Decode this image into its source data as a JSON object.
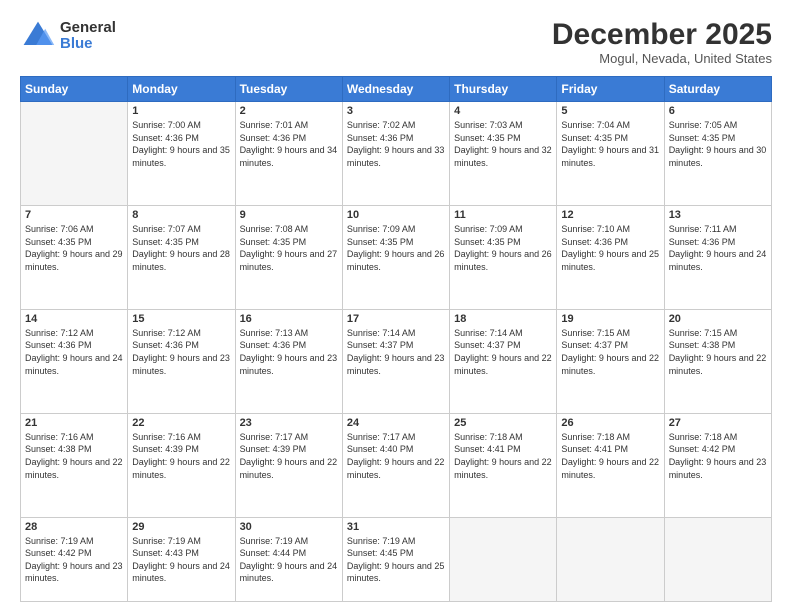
{
  "logo": {
    "general": "General",
    "blue": "Blue"
  },
  "title": "December 2025",
  "subtitle": "Mogul, Nevada, United States",
  "days_of_week": [
    "Sunday",
    "Monday",
    "Tuesday",
    "Wednesday",
    "Thursday",
    "Friday",
    "Saturday"
  ],
  "weeks": [
    [
      {
        "day": "",
        "empty": true
      },
      {
        "day": "1",
        "sunrise": "7:00 AM",
        "sunset": "4:36 PM",
        "daylight": "9 hours and 35 minutes."
      },
      {
        "day": "2",
        "sunrise": "7:01 AM",
        "sunset": "4:36 PM",
        "daylight": "9 hours and 34 minutes."
      },
      {
        "day": "3",
        "sunrise": "7:02 AM",
        "sunset": "4:36 PM",
        "daylight": "9 hours and 33 minutes."
      },
      {
        "day": "4",
        "sunrise": "7:03 AM",
        "sunset": "4:35 PM",
        "daylight": "9 hours and 32 minutes."
      },
      {
        "day": "5",
        "sunrise": "7:04 AM",
        "sunset": "4:35 PM",
        "daylight": "9 hours and 31 minutes."
      },
      {
        "day": "6",
        "sunrise": "7:05 AM",
        "sunset": "4:35 PM",
        "daylight": "9 hours and 30 minutes."
      }
    ],
    [
      {
        "day": "7",
        "sunrise": "7:06 AM",
        "sunset": "4:35 PM",
        "daylight": "9 hours and 29 minutes."
      },
      {
        "day": "8",
        "sunrise": "7:07 AM",
        "sunset": "4:35 PM",
        "daylight": "9 hours and 28 minutes."
      },
      {
        "day": "9",
        "sunrise": "7:08 AM",
        "sunset": "4:35 PM",
        "daylight": "9 hours and 27 minutes."
      },
      {
        "day": "10",
        "sunrise": "7:09 AM",
        "sunset": "4:35 PM",
        "daylight": "9 hours and 26 minutes."
      },
      {
        "day": "11",
        "sunrise": "7:09 AM",
        "sunset": "4:35 PM",
        "daylight": "9 hours and 26 minutes."
      },
      {
        "day": "12",
        "sunrise": "7:10 AM",
        "sunset": "4:36 PM",
        "daylight": "9 hours and 25 minutes."
      },
      {
        "day": "13",
        "sunrise": "7:11 AM",
        "sunset": "4:36 PM",
        "daylight": "9 hours and 24 minutes."
      }
    ],
    [
      {
        "day": "14",
        "sunrise": "7:12 AM",
        "sunset": "4:36 PM",
        "daylight": "9 hours and 24 minutes."
      },
      {
        "day": "15",
        "sunrise": "7:12 AM",
        "sunset": "4:36 PM",
        "daylight": "9 hours and 23 minutes."
      },
      {
        "day": "16",
        "sunrise": "7:13 AM",
        "sunset": "4:36 PM",
        "daylight": "9 hours and 23 minutes."
      },
      {
        "day": "17",
        "sunrise": "7:14 AM",
        "sunset": "4:37 PM",
        "daylight": "9 hours and 23 minutes."
      },
      {
        "day": "18",
        "sunrise": "7:14 AM",
        "sunset": "4:37 PM",
        "daylight": "9 hours and 22 minutes."
      },
      {
        "day": "19",
        "sunrise": "7:15 AM",
        "sunset": "4:37 PM",
        "daylight": "9 hours and 22 minutes."
      },
      {
        "day": "20",
        "sunrise": "7:15 AM",
        "sunset": "4:38 PM",
        "daylight": "9 hours and 22 minutes."
      }
    ],
    [
      {
        "day": "21",
        "sunrise": "7:16 AM",
        "sunset": "4:38 PM",
        "daylight": "9 hours and 22 minutes."
      },
      {
        "day": "22",
        "sunrise": "7:16 AM",
        "sunset": "4:39 PM",
        "daylight": "9 hours and 22 minutes."
      },
      {
        "day": "23",
        "sunrise": "7:17 AM",
        "sunset": "4:39 PM",
        "daylight": "9 hours and 22 minutes."
      },
      {
        "day": "24",
        "sunrise": "7:17 AM",
        "sunset": "4:40 PM",
        "daylight": "9 hours and 22 minutes."
      },
      {
        "day": "25",
        "sunrise": "7:18 AM",
        "sunset": "4:41 PM",
        "daylight": "9 hours and 22 minutes."
      },
      {
        "day": "26",
        "sunrise": "7:18 AM",
        "sunset": "4:41 PM",
        "daylight": "9 hours and 22 minutes."
      },
      {
        "day": "27",
        "sunrise": "7:18 AM",
        "sunset": "4:42 PM",
        "daylight": "9 hours and 23 minutes."
      }
    ],
    [
      {
        "day": "28",
        "sunrise": "7:19 AM",
        "sunset": "4:42 PM",
        "daylight": "9 hours and 23 minutes."
      },
      {
        "day": "29",
        "sunrise": "7:19 AM",
        "sunset": "4:43 PM",
        "daylight": "9 hours and 24 minutes."
      },
      {
        "day": "30",
        "sunrise": "7:19 AM",
        "sunset": "4:44 PM",
        "daylight": "9 hours and 24 minutes."
      },
      {
        "day": "31",
        "sunrise": "7:19 AM",
        "sunset": "4:45 PM",
        "daylight": "9 hours and 25 minutes."
      },
      {
        "day": "",
        "empty": true
      },
      {
        "day": "",
        "empty": true
      },
      {
        "day": "",
        "empty": true
      }
    ]
  ]
}
